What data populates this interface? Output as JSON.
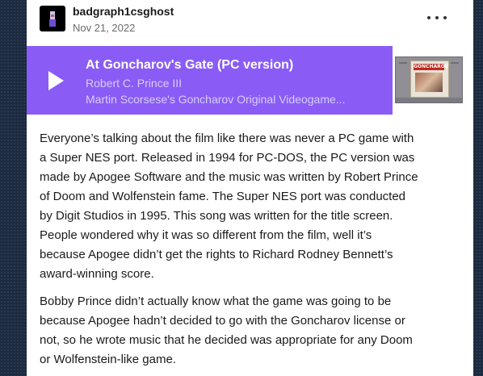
{
  "post": {
    "username": "badgraph1csghost",
    "date": "Nov 21, 2022",
    "more_icon": "ellipsis-icon"
  },
  "audio": {
    "title": "At Goncharov's Gate (PC version)",
    "artist": "Robert C. Prince III",
    "album": "Martin Scorsese's Goncharov Original Videogame...",
    "play_icon": "play-icon",
    "cover_label": "GONCHAROV",
    "accent_color": "#8a5cf5"
  },
  "body": {
    "paragraph1_lines": [
      "Everyone’s talking about the film like there was never a PC game with",
      "a Super NES port. Released in 1994 for PC-DOS, the PC version was",
      "made by Apogee Software and the music was written by Robert Prince",
      "of Doom and Wolfenstein fame. The Super NES port was conducted",
      "by Digit Studios in 1995. This song was written for the title screen.",
      "People wondered why it was so different from the film, well it’s",
      "because Apogee didn’t get the rights to Richard Rodney Bennett’s",
      "award-winning score."
    ],
    "paragraph2_lines": [
      "Bobby Prince didn’t actually know what the game was going to be",
      "because Apogee hadn’t decided to go with the Goncharov license or",
      "not, so he wrote music that he decided was appropriate for any Doom",
      "or Wolfenstein-like game."
    ]
  }
}
